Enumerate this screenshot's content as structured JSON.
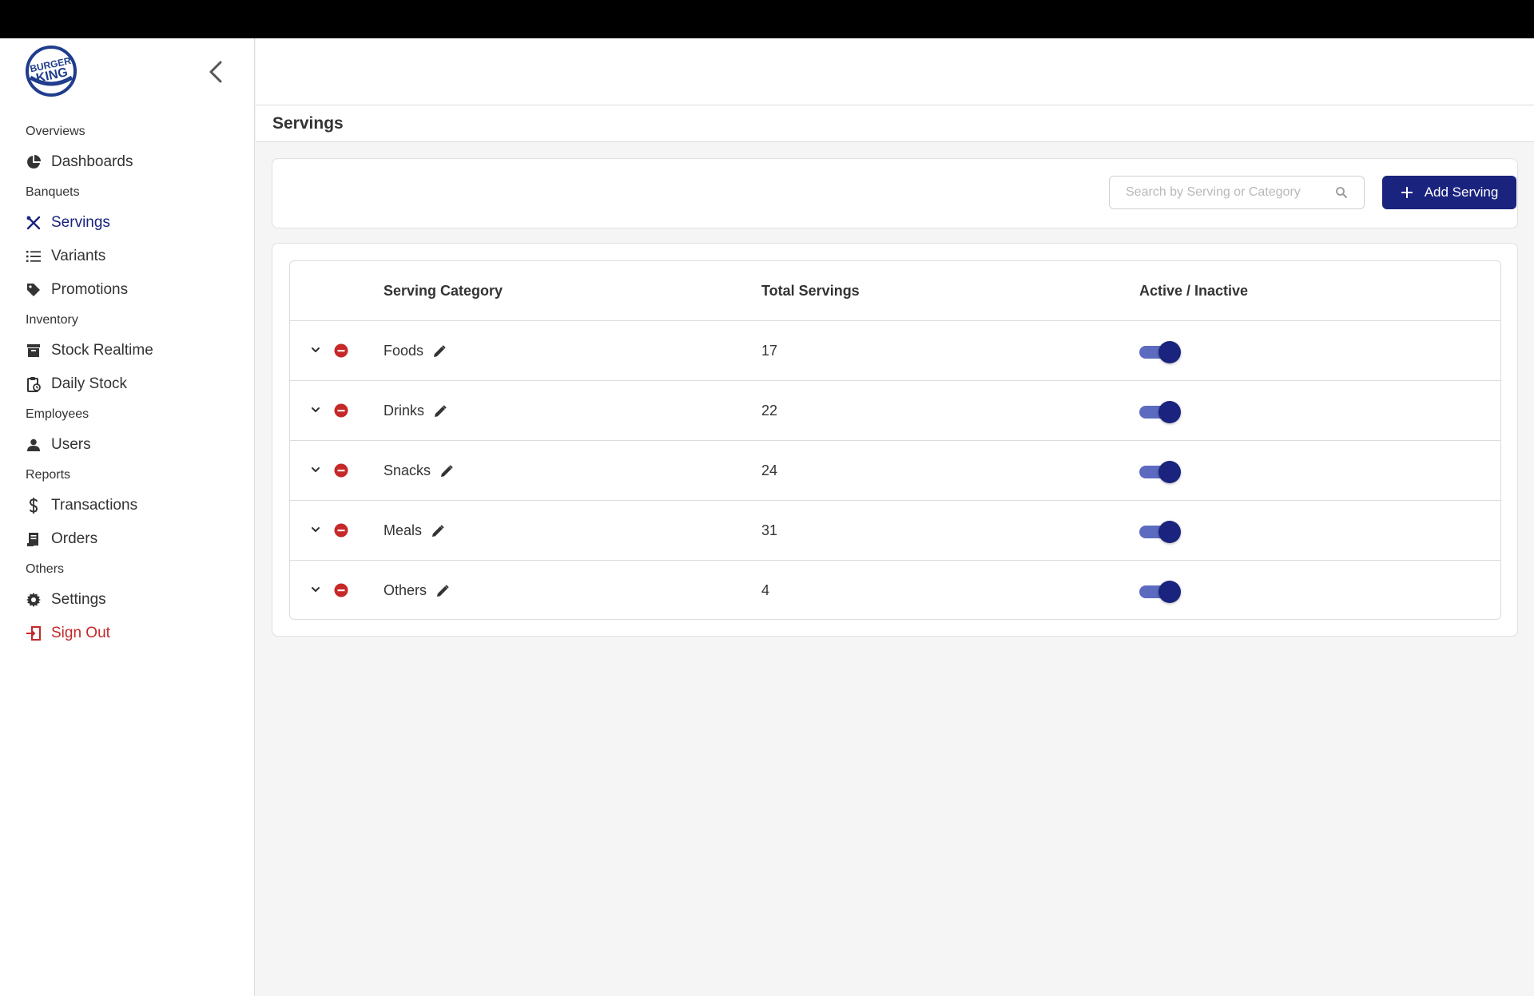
{
  "brand": {
    "logo_text_top": "BURGER",
    "logo_text_bottom": "KING",
    "primary_color": "#1a237e",
    "logo_color": "#1f3d8c",
    "danger_color": "#c62828"
  },
  "sidebar": {
    "sections": [
      {
        "title": "Overviews",
        "items": [
          {
            "label": "Dashboards",
            "icon": "pie-chart-icon"
          }
        ]
      },
      {
        "title": "Banquets",
        "items": [
          {
            "label": "Servings",
            "icon": "utensils-icon",
            "active": true
          },
          {
            "label": "Variants",
            "icon": "list-icon"
          },
          {
            "label": "Promotions",
            "icon": "tag-icon"
          }
        ]
      },
      {
        "title": "Inventory",
        "items": [
          {
            "label": "Stock Realtime",
            "icon": "archive-icon"
          },
          {
            "label": "Daily Stock",
            "icon": "clipboard-clock-icon"
          }
        ]
      },
      {
        "title": "Employees",
        "items": [
          {
            "label": "Users",
            "icon": "user-icon"
          }
        ]
      },
      {
        "title": "Reports",
        "items": [
          {
            "label": "Transactions",
            "icon": "dollar-icon"
          },
          {
            "label": "Orders",
            "icon": "receipt-icon"
          }
        ]
      },
      {
        "title": "Others",
        "items": [
          {
            "label": "Settings",
            "icon": "gear-icon"
          },
          {
            "label": "Sign Out",
            "icon": "sign-out-icon",
            "danger": true
          }
        ]
      }
    ]
  },
  "page": {
    "title": "Servings"
  },
  "toolbar": {
    "search_placeholder": "Search by Serving or Category",
    "search_value": "",
    "add_label": "Add Serving"
  },
  "table": {
    "columns": {
      "category": "Serving Category",
      "total": "Total Servings",
      "status": "Active / Inactive"
    },
    "rows": [
      {
        "category": "Foods",
        "total": "17",
        "active": true
      },
      {
        "category": "Drinks",
        "total": "22",
        "active": true
      },
      {
        "category": "Snacks",
        "total": "24",
        "active": true
      },
      {
        "category": "Meals",
        "total": "31",
        "active": true
      },
      {
        "category": "Others",
        "total": "4",
        "active": true
      }
    ]
  }
}
